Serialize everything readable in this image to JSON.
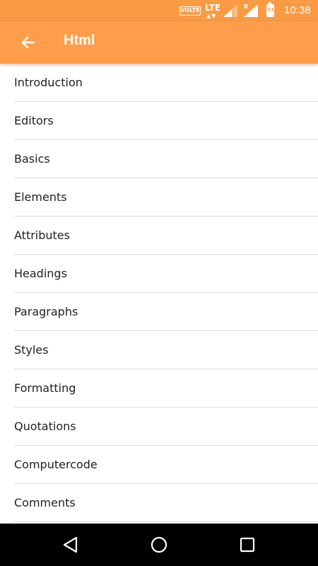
{
  "status_bar": {
    "volte": "VOLTE",
    "network": "LTE",
    "roaming": "R",
    "battery": "33",
    "time": "10:38",
    "color": "#f99a44"
  },
  "app_bar": {
    "title": "Html",
    "back_icon": "arrow-back-icon",
    "color": "#fe9d4a"
  },
  "topics": [
    {
      "label": "Introduction"
    },
    {
      "label": "Editors"
    },
    {
      "label": "Basics"
    },
    {
      "label": "Elements"
    },
    {
      "label": "Attributes"
    },
    {
      "label": "Headings"
    },
    {
      "label": "Paragraphs"
    },
    {
      "label": "Styles"
    },
    {
      "label": "Formatting"
    },
    {
      "label": "Quotations"
    },
    {
      "label": "Computercode"
    },
    {
      "label": "Comments"
    },
    {
      "label": ""
    }
  ],
  "nav_bar": {
    "back_icon": "triangle-back-icon",
    "home_icon": "circle-home-icon",
    "recents_icon": "square-recents-icon"
  }
}
